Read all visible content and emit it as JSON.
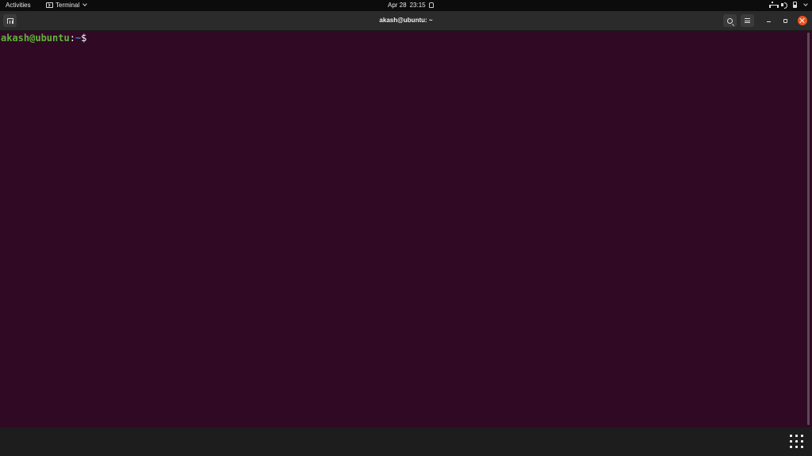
{
  "topbar": {
    "activities": "Activities",
    "app_menu": "Terminal",
    "date": "Apr 28",
    "time": "23:15"
  },
  "window": {
    "title": "akash@ubuntu: ~"
  },
  "terminal": {
    "user_host": "akash@ubuntu",
    "colon": ":",
    "path": "~",
    "dollar": "$"
  },
  "colors": {
    "terminal_bg": "#300a24",
    "prompt_user": "#5fb43a",
    "prompt_path": "#4f7fbf",
    "close_accent": "#e95420"
  },
  "icons": [
    "terminal-icon",
    "alarm-icon",
    "network-icon",
    "volume-icon",
    "battery-icon",
    "new-tab-icon",
    "search-icon",
    "hamburger-menu-icon",
    "minimize-icon",
    "maximize-icon",
    "close-icon",
    "show-apps-icon"
  ]
}
